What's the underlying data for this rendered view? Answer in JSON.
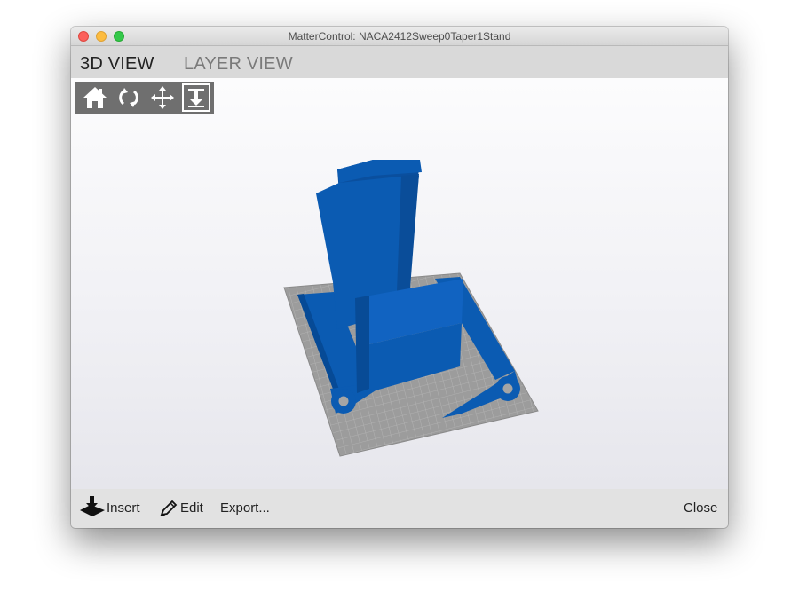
{
  "window": {
    "title": "MatterControl: NACA2412Sweep0Taper1Stand"
  },
  "tabs": [
    {
      "label": "3D VIEW",
      "active": true
    },
    {
      "label": "LAYER VIEW",
      "active": false
    }
  ],
  "viewport_toolbar": {
    "tools": [
      {
        "icon": "home-icon",
        "selected": false
      },
      {
        "icon": "rotate-icon",
        "selected": false
      },
      {
        "icon": "move-icon",
        "selected": false
      },
      {
        "icon": "zoom-icon",
        "selected": true
      }
    ]
  },
  "bottom_bar": {
    "insert_label": "Insert",
    "edit_label": "Edit",
    "export_label": "Export...",
    "close_label": "Close"
  },
  "colors": {
    "model_blue": "#0b5bb2",
    "model_blue_dark": "#064a96",
    "bed_grey": "#9c9c9c",
    "toolbar_grey": "#6f6f6f"
  }
}
